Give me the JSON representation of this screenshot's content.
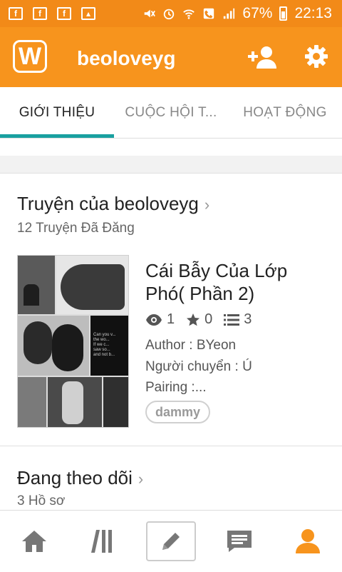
{
  "status_bar": {
    "battery": "67%",
    "time": "22:13",
    "colors": {
      "background": "#f28a18"
    }
  },
  "app_bar": {
    "logo_letter": "W",
    "title": "beoloveyg",
    "icons": [
      "add-user-icon",
      "settings-icon"
    ],
    "color": "#f7941d"
  },
  "tabs": {
    "items": [
      {
        "label": "GIỚI THIỆU",
        "active": true
      },
      {
        "label": "CUỘC HỘI T...",
        "active": false
      },
      {
        "label": "HOẠT ĐỘNG",
        "active": false
      }
    ],
    "indicator_color": "#19a0a0"
  },
  "stories": {
    "title": "Truyện của beoloveyg",
    "subtitle": "12 Truyện Đã Đăng",
    "item": {
      "title": "Cái Bẫy Của Lớp Phó( Phần 2)",
      "views": "1",
      "votes": "0",
      "parts": "3",
      "desc_lines": [
        "Author : BYeon",
        "Người chuyển : Ú",
        "Pairing :..."
      ],
      "tag": "dammy"
    }
  },
  "following": {
    "title": "Đang theo dõi",
    "subtitle": "3 Hồ sơ"
  },
  "bottom_nav": {
    "items": [
      "home-icon",
      "library-icon",
      "write-icon",
      "messages-icon",
      "profile-icon"
    ],
    "active": "profile-icon",
    "active_color": "#f7941d"
  }
}
